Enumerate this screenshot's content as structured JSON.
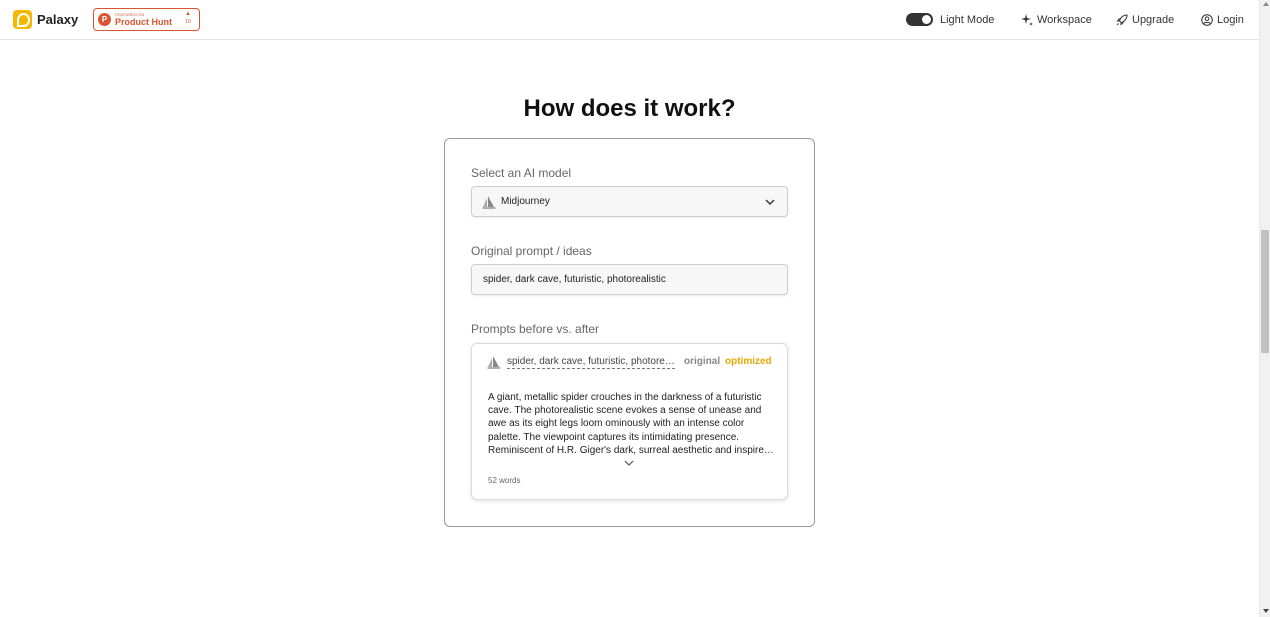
{
  "header": {
    "brand": "Palaxy",
    "product_hunt": {
      "small_text": "FEATURED ON",
      "name": "Product Hunt",
      "vote_arrow": "▲",
      "vote_count": "10",
      "icon_letter": "P"
    },
    "nav": {
      "light_mode": "Light Mode",
      "workspace": "Workspace",
      "upgrade": "Upgrade",
      "login": "Login"
    }
  },
  "main": {
    "title": "How does it work?",
    "model_select": {
      "label": "Select an AI model",
      "value": "Midjourney"
    },
    "prompt_input": {
      "label": "Original prompt / ideas",
      "value": "spider, dark cave, futuristic, photorealistic"
    },
    "compare": {
      "label": "Prompts before vs. after",
      "prompt": "spider, dark cave, futuristic, photorealistic",
      "tab_original": "original",
      "tab_optimized": "optimized",
      "lines": [
        "A giant, metallic spider crouches in the darkness of a futuristic",
        "cave. The photorealistic scene evokes a sense of unease and",
        "awe as its eight legs loom ominously with an intense color",
        "palette. The viewpoint captures its intimidating presence.",
        "Reminiscent of H.R. Giger's dark, surreal aesthetic and inspired by"
      ],
      "word_count": "52 words"
    }
  },
  "colors": {
    "accent": "#e6a700",
    "brand": "#f5b800",
    "product_hunt": "#da552f"
  }
}
